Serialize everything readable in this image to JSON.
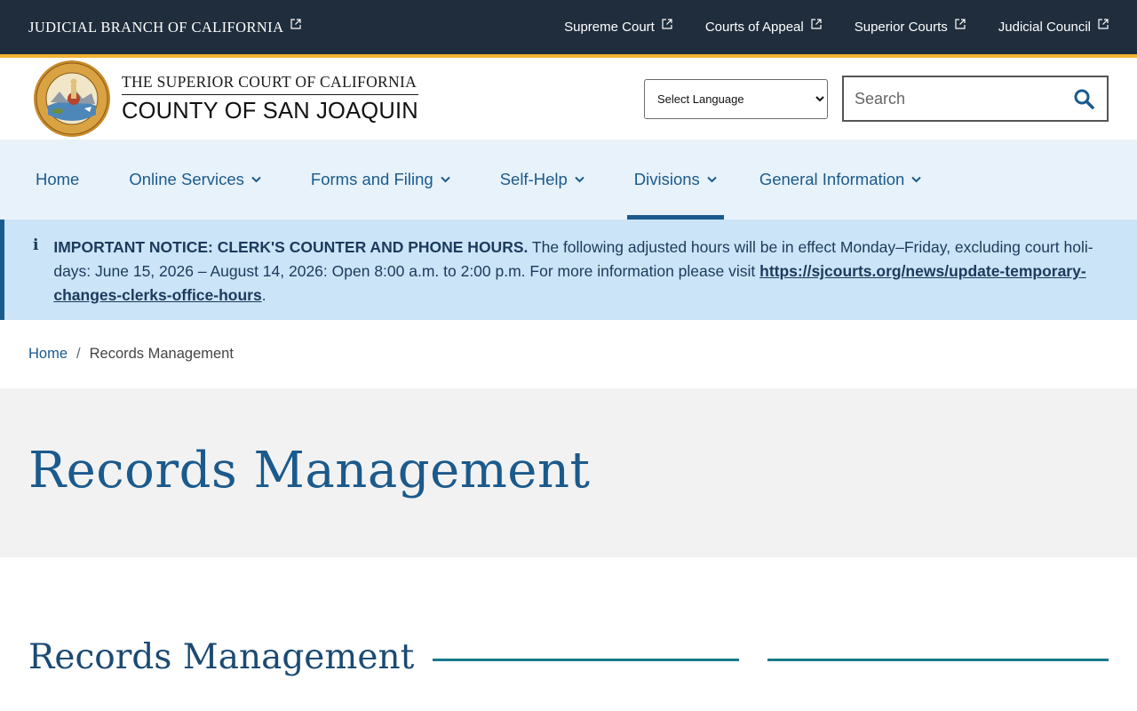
{
  "topbar": {
    "brand": "JUDICIAL BRANCH OF CALIFORNIA",
    "links": [
      "Supreme Court",
      "Courts of Appeal",
      "Superior Courts",
      "Judicial Council"
    ]
  },
  "header": {
    "court_line1": "THE SUPERIOR COURT OF CALIFORNIA",
    "court_line2": "COUNTY OF SAN JOAQUIN",
    "language_selected": "Select Language",
    "search_placeholder": "Search"
  },
  "nav": {
    "items": [
      {
        "label": "Home"
      },
      {
        "label": "Online Services"
      },
      {
        "label": "Forms and Filing"
      },
      {
        "label": "Self-Help"
      },
      {
        "label": "Divisions"
      },
      {
        "label": "General Information"
      }
    ]
  },
  "notice": {
    "icon": "info-icon",
    "heading": "IMPORTANT NOTICE: CLERK'S COUNTER AND PHONE HOURS.",
    "body": " The following adjusted hours will be in effect Monday–Friday, excluding court holi-days: June 15, 2026 – August 14, 2026: Open 8:00 a.m. to 2:00 p.m. For more information please visit ",
    "link": "https://sjcourts.org/news/update-temporary-changes-clerks-office-hours",
    "end": "."
  },
  "breadcrumb": {
    "home": "Home",
    "separator": "/",
    "current": "Records Management"
  },
  "hero": {
    "title": "Records Management"
  },
  "section": {
    "title": "Records Management"
  },
  "colors": {
    "topbar": "#1f2d3d",
    "gold": "#f2b230",
    "nav_bg": "#e8f2fa",
    "brand_blue": "#1b5a8c",
    "notice_bg": "#cce4f7",
    "rule": "#1a7a8a"
  }
}
